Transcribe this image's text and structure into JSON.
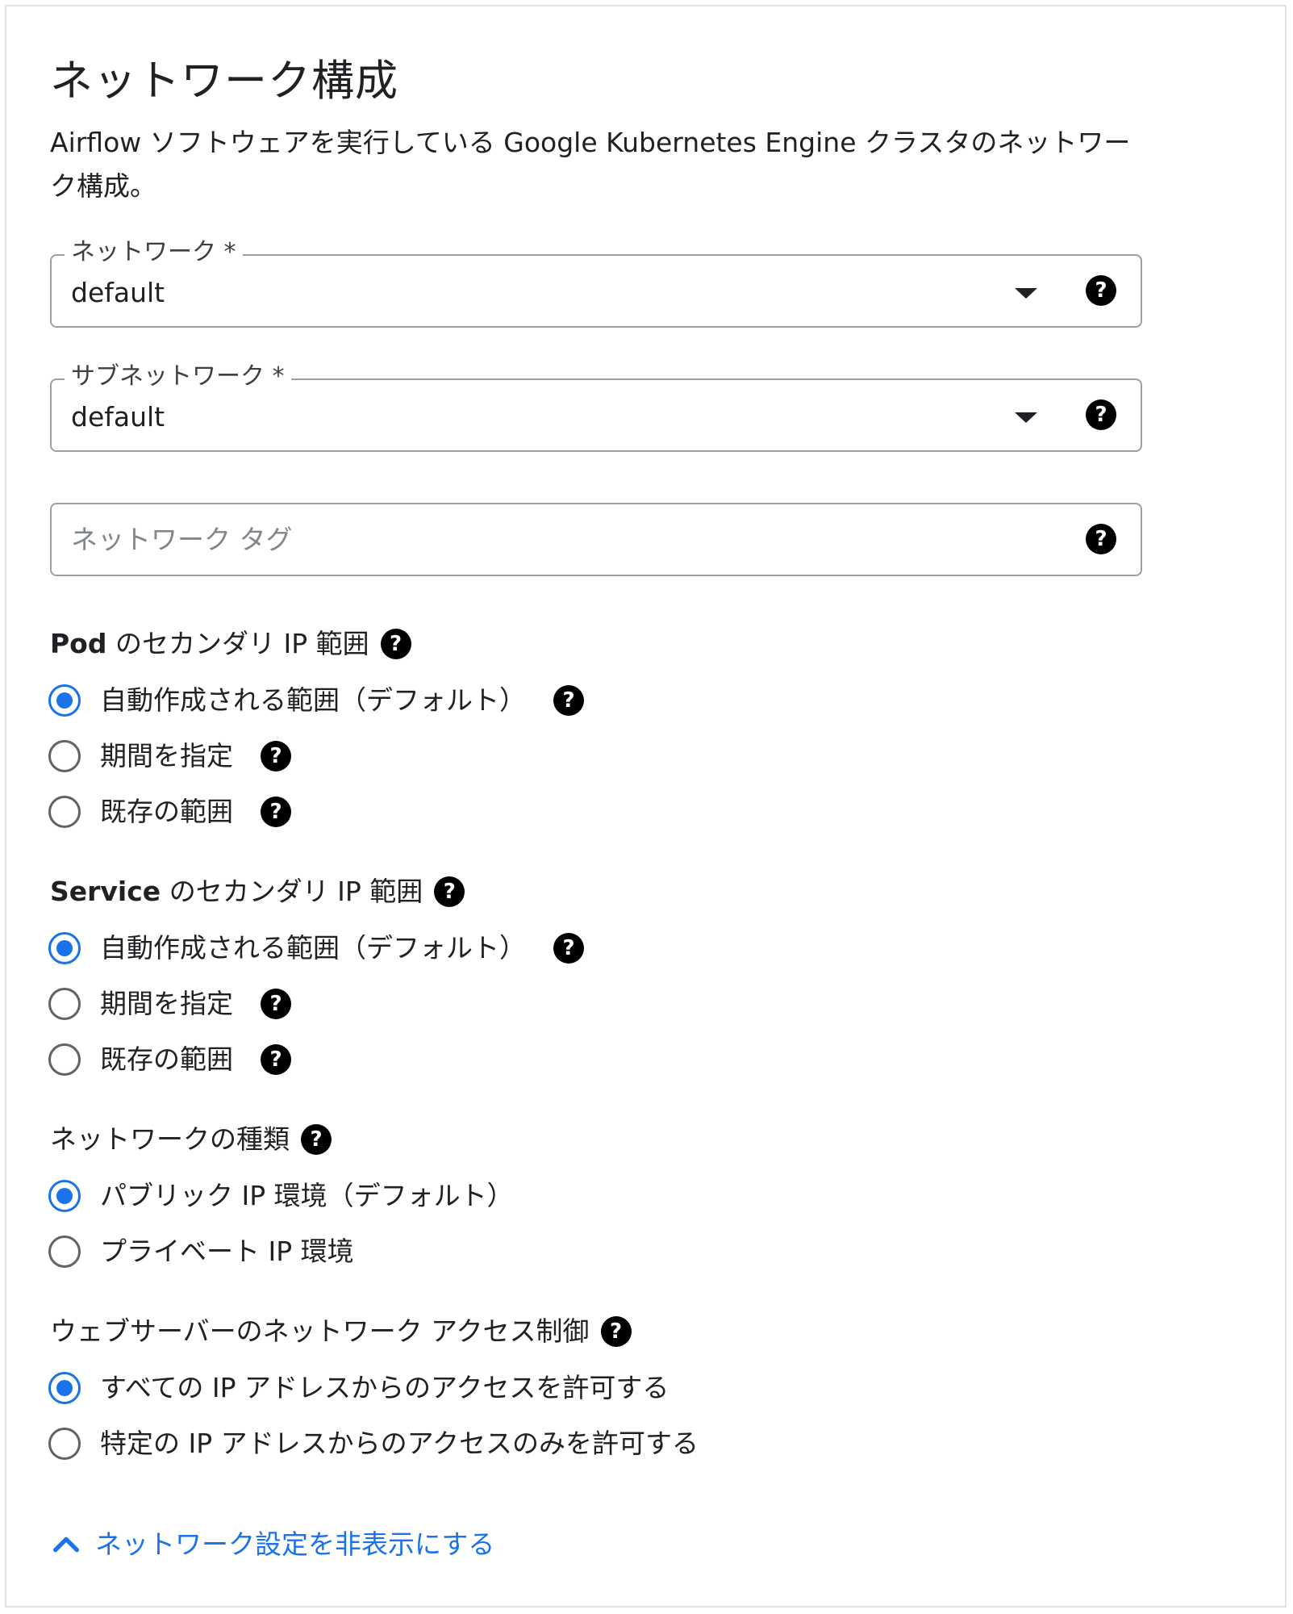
{
  "title": "ネットワーク構成",
  "description": "Airflow ソフトウェアを実行している Google Kubernetes Engine クラスタのネットワーク構成。",
  "network": {
    "label": "ネットワーク *",
    "value": "default"
  },
  "subnetwork": {
    "label": "サブネットワーク *",
    "value": "default"
  },
  "network_tags": {
    "placeholder": "ネットワーク タグ"
  },
  "help_glyph": "?",
  "pod_range": {
    "title_bold": "Pod",
    "title_rest": " のセカンダリ IP 範囲",
    "options": [
      {
        "label": "自動作成される範囲（デフォルト）",
        "selected": true
      },
      {
        "label": "期間を指定",
        "selected": false
      },
      {
        "label": "既存の範囲",
        "selected": false
      }
    ]
  },
  "service_range": {
    "title_bold": "Service",
    "title_rest": " のセカンダリ IP 範囲",
    "options": [
      {
        "label": "自動作成される範囲（デフォルト）",
        "selected": true
      },
      {
        "label": "期間を指定",
        "selected": false
      },
      {
        "label": "既存の範囲",
        "selected": false
      }
    ]
  },
  "network_type": {
    "title": "ネットワークの種類",
    "options": [
      {
        "label": "パブリック IP 環境（デフォルト）",
        "selected": true
      },
      {
        "label": "プライベート IP 環境",
        "selected": false
      }
    ]
  },
  "webserver_access": {
    "title": "ウェブサーバーのネットワーク アクセス制御",
    "options": [
      {
        "label": "すべての IP アドレスからのアクセスを許可する",
        "selected": true
      },
      {
        "label": "特定の IP アドレスからのアクセスのみを許可する",
        "selected": false
      }
    ]
  },
  "toggle_link": "ネットワーク設定を非表示にする",
  "colors": {
    "accent": "#1a73e8",
    "border": "#9aa0a6",
    "text": "#202124"
  }
}
